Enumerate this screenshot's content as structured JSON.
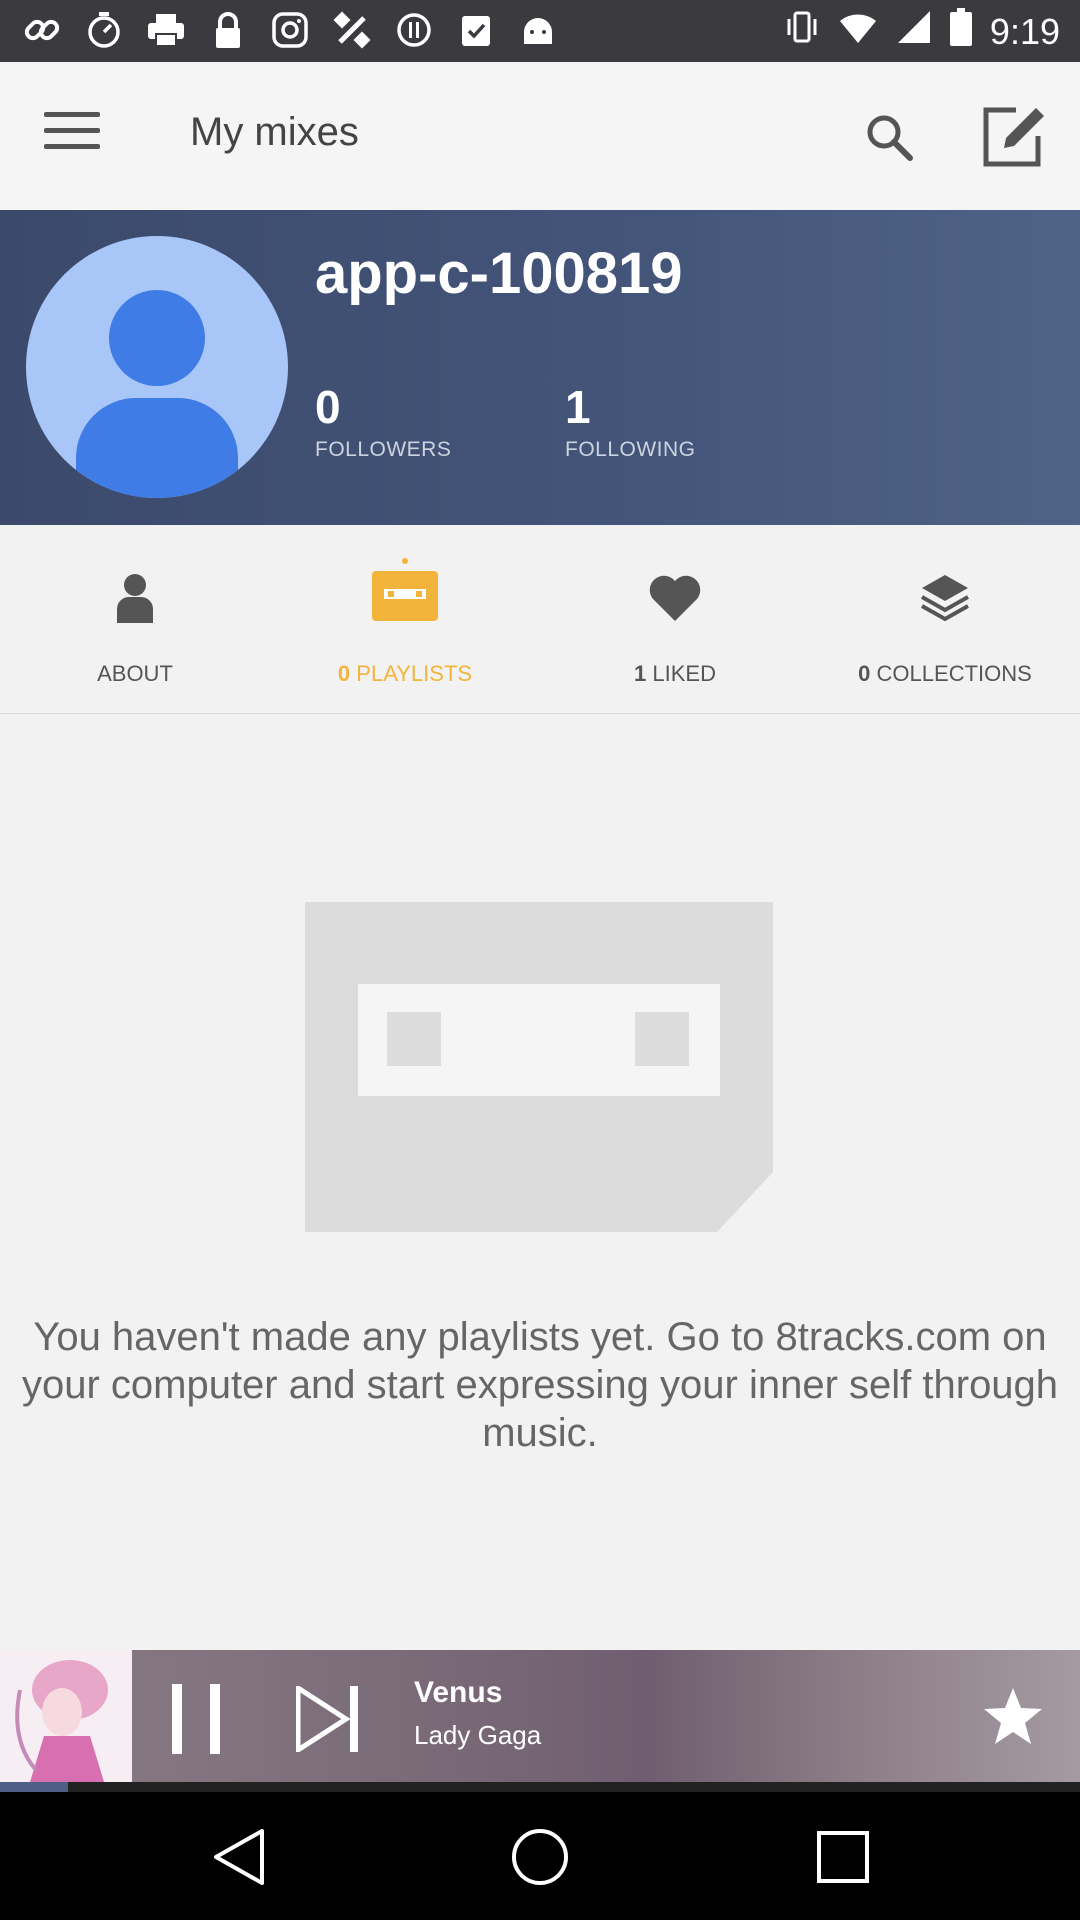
{
  "status_bar": {
    "time": "9:19",
    "left_icons": [
      "link-icon",
      "timer-icon",
      "printer-icon",
      "lock-icon",
      "instagram-icon",
      "fake-gps-icon",
      "settings-circle-icon",
      "clipboard-check-icon",
      "android-icon"
    ],
    "right_icons": [
      "vibrate-icon",
      "wifi-icon",
      "signal-icon",
      "battery-icon"
    ]
  },
  "app_bar": {
    "title": "My mixes",
    "icons": [
      "menu-icon",
      "search-icon",
      "compose-icon"
    ]
  },
  "profile": {
    "username": "app-c-100819",
    "followers_count": "0",
    "followers_label": "FOLLOWERS",
    "following_count": "1",
    "following_label": "FOLLOWING",
    "avatar_icon": "person-avatar-icon"
  },
  "tabs": [
    {
      "count": "",
      "label": "ABOUT",
      "icon": "person-icon",
      "active": false
    },
    {
      "count": "0",
      "label": "PLAYLISTS",
      "icon": "cassette-icon",
      "active": true
    },
    {
      "count": "1",
      "label": "LIKED",
      "icon": "heart-icon",
      "active": false
    },
    {
      "count": "0",
      "label": "COLLECTIONS",
      "icon": "layers-icon",
      "active": false
    }
  ],
  "empty_state": {
    "message": "You haven't made any playlists yet. Go to 8tracks.com on your computer and start expressing your inner self through music.",
    "icon": "empty-cassette-icon"
  },
  "player": {
    "track_title": "Venus",
    "artist": "Lady Gaga",
    "icons": [
      "pause-icon",
      "skip-next-icon",
      "star-icon"
    ]
  },
  "nav_bar": {
    "icons": [
      "back-icon",
      "home-icon",
      "recents-icon"
    ]
  },
  "colors": {
    "accent": "#f3b43c",
    "profile_bg": "#44557a",
    "avatar_bg": "#a8c6f7",
    "avatar_fg": "#3f7ce6"
  }
}
